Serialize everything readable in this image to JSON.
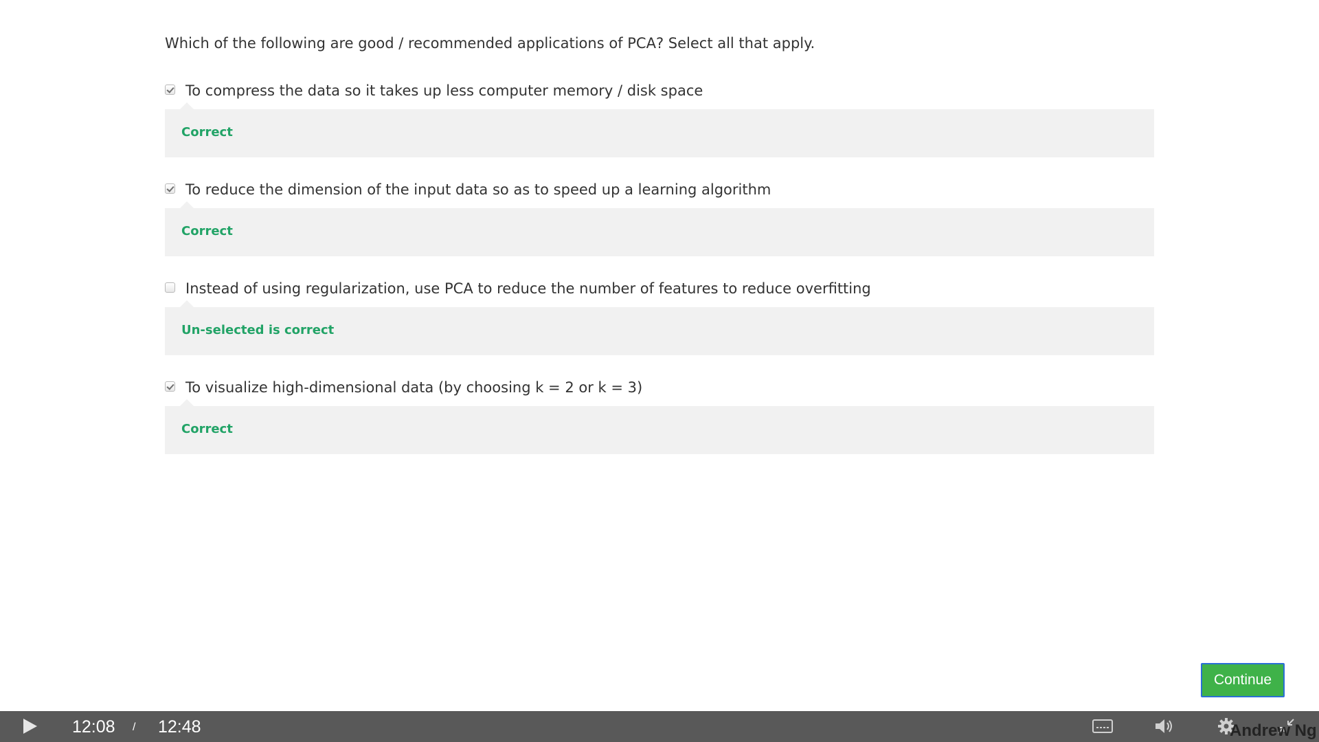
{
  "question": {
    "text": "Which of the following are good / recommended applications of PCA? Select all that apply."
  },
  "options": [
    {
      "label": "To compress the data so it takes up less computer memory / disk space",
      "checked": true,
      "feedback": "Correct"
    },
    {
      "label": "To reduce the dimension of the input data so as to speed up a learning algorithm",
      "checked": true,
      "feedback": "Correct"
    },
    {
      "label": "Instead of using regularization, use PCA to reduce the number of features to reduce overfitting",
      "checked": false,
      "feedback": "Un-selected is correct"
    },
    {
      "label": "To visualize high-dimensional data (by choosing k = 2 or k = 3)",
      "checked": true,
      "feedback": "Correct"
    }
  ],
  "continue_button": {
    "label": "Continue"
  },
  "player": {
    "current_time": "12:08",
    "separator": "/",
    "total_time": "12:48",
    "watermark": "Andrew Ng"
  },
  "colors": {
    "feedback_green": "#21a366",
    "button_green": "#3fb249",
    "control_bar": "#595959",
    "feedback_bg": "#f1f1f1"
  },
  "icons": {
    "play": "play-icon",
    "captions": "cc-icon",
    "volume": "volume-icon",
    "settings": "gear-icon",
    "exit_fullscreen": "exit-fullscreen-icon"
  }
}
